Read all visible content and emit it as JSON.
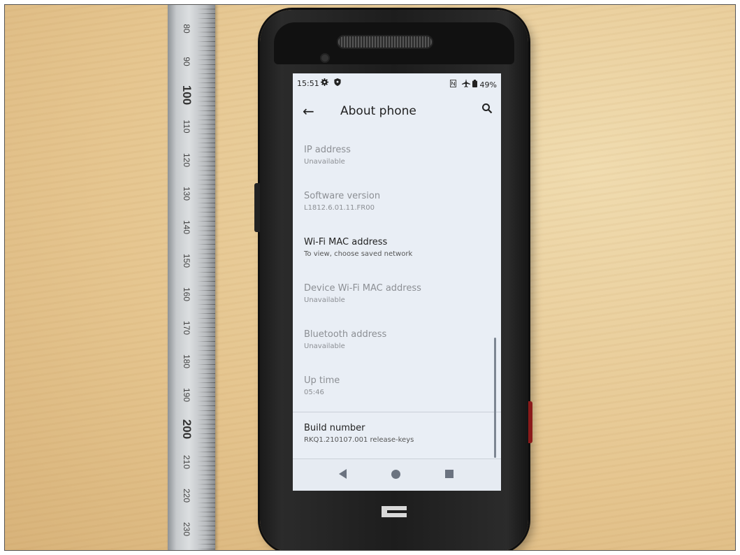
{
  "ruler": {
    "labels": [
      "80",
      "90",
      "100",
      "110",
      "120",
      "130",
      "140",
      "150",
      "160",
      "170",
      "180",
      "190",
      "200",
      "210",
      "220",
      "230"
    ]
  },
  "status_bar": {
    "time": "15:51",
    "battery": "49%"
  },
  "app_bar": {
    "title": "About phone"
  },
  "items": [
    {
      "label": "IP address",
      "value": "Unavailable"
    },
    {
      "label": "Software version",
      "value": "L1812.6.01.11.FR00"
    },
    {
      "label": "Wi-Fi MAC address",
      "value": "To view, choose saved network"
    },
    {
      "label": "Device Wi-Fi MAC address",
      "value": "Unavailable"
    },
    {
      "label": "Bluetooth address",
      "value": "Unavailable"
    },
    {
      "label": "Up time",
      "value": "05:46"
    },
    {
      "label": "Build number",
      "value": "RKQ1.210107.001 release-keys"
    }
  ],
  "icons": [
    "settings-gear-icon",
    "shield-icon",
    "nfc-icon",
    "airplane-icon",
    "battery-icon",
    "back-arrow-icon",
    "search-icon",
    "nav-back-icon",
    "nav-home-icon",
    "nav-recents-icon"
  ]
}
